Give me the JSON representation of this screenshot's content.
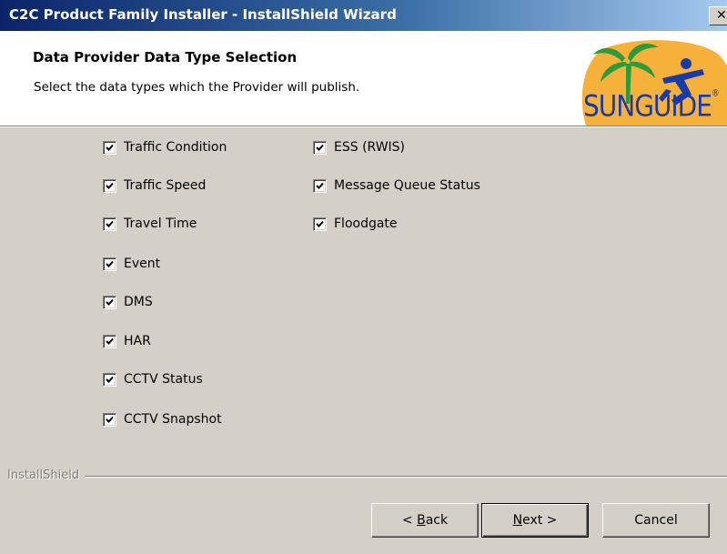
{
  "window": {
    "title": "C2C Product Family Installer - InstallShield Wizard",
    "close_glyph": "✕"
  },
  "header": {
    "title": "Data Provider Data Type Selection",
    "subtitle": "Select the data types which the Provider will publish.",
    "logo_text": "SUNGUIDE",
    "logo_mark": "®"
  },
  "checkboxes": {
    "left": [
      {
        "label": "Traffic Condition",
        "checked": true
      },
      {
        "label": "Traffic Speed",
        "checked": true
      },
      {
        "label": "Travel Time",
        "checked": true
      },
      {
        "label": "Event",
        "checked": true
      },
      {
        "label": "DMS",
        "checked": true
      },
      {
        "label": "HAR",
        "checked": true
      },
      {
        "label": "CCTV Status",
        "checked": true
      },
      {
        "label": "CCTV Snapshot",
        "checked": true
      }
    ],
    "right": [
      {
        "label": "ESS (RWIS)",
        "checked": true
      },
      {
        "label": "Message Queue Status",
        "checked": true
      },
      {
        "label": "Floodgate",
        "checked": true
      }
    ]
  },
  "footer": {
    "brand": "InstallShield",
    "back_prefix": "< ",
    "back_key": "B",
    "back_rest": "ack",
    "next_key": "N",
    "next_rest": "ext >",
    "cancel_label": "Cancel"
  },
  "colors": {
    "titlebar_start": "#0a246a",
    "titlebar_end": "#a6caf0",
    "dialog_face": "#d4d0c8",
    "logo_orange": "#f4a318",
    "logo_blue": "#1a3aa8",
    "logo_green": "#2e9a3a"
  }
}
